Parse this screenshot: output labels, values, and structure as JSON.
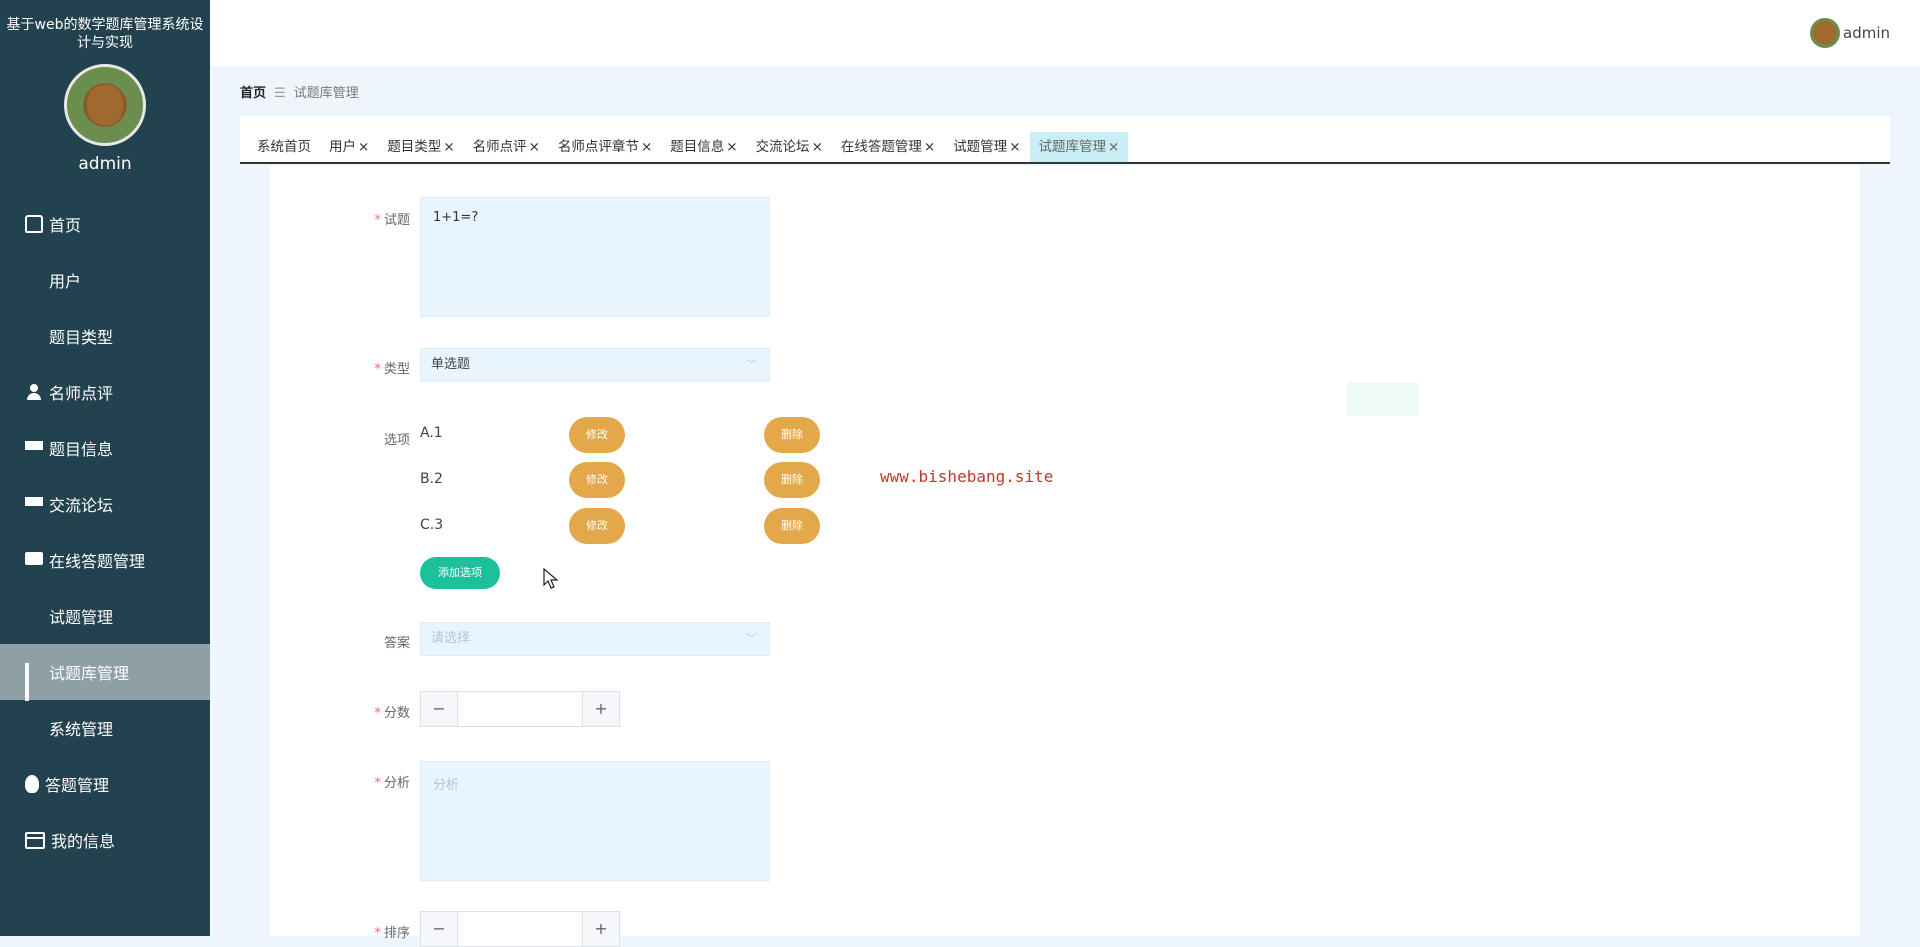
{
  "sidebar": {
    "system_title": "基于web的数学题库管理系统设计与实现",
    "username": "admin",
    "items": [
      {
        "label": "首页",
        "icon": "home-icon"
      },
      {
        "label": "用户",
        "icon": "grid-icon"
      },
      {
        "label": "题目类型",
        "icon": "grid-icon"
      },
      {
        "label": "名师点评",
        "icon": "user-icon"
      },
      {
        "label": "题目信息",
        "icon": "list-icon"
      },
      {
        "label": "交流论坛",
        "icon": "list-icon"
      },
      {
        "label": "在线答题管理",
        "icon": "chat-icon"
      },
      {
        "label": "试题管理",
        "icon": "grid-icon"
      },
      {
        "label": "试题库管理",
        "icon": "bar-chart-icon",
        "active": true
      },
      {
        "label": "系统管理",
        "icon": "grid-icon"
      },
      {
        "label": "答题管理",
        "icon": "bulb-icon"
      },
      {
        "label": "我的信息",
        "icon": "card-icon"
      }
    ]
  },
  "header": {
    "username": "admin"
  },
  "breadcrumb": {
    "home": "首页",
    "separator": "☰",
    "current": "试题库管理"
  },
  "tabs": [
    {
      "label": "系统首页",
      "closable": false
    },
    {
      "label": "用户",
      "closable": true
    },
    {
      "label": "题目类型",
      "closable": true
    },
    {
      "label": "名师点评",
      "closable": true
    },
    {
      "label": "名师点评章节",
      "closable": true
    },
    {
      "label": "题目信息",
      "closable": true
    },
    {
      "label": "交流论坛",
      "closable": true
    },
    {
      "label": "在线答题管理",
      "closable": true
    },
    {
      "label": "试题管理",
      "closable": true
    },
    {
      "label": "试题库管理",
      "closable": true,
      "active": true
    }
  ],
  "close_glyph": "×",
  "form": {
    "question_label": "试题",
    "question_value": "1+1=?",
    "type_label": "类型",
    "type_value": "单选题",
    "options_label": "选项",
    "options": [
      {
        "text": "A.1"
      },
      {
        "text": "B.2"
      },
      {
        "text": "C.3"
      }
    ],
    "edit_label": "修改",
    "delete_label": "删除",
    "add_option_label": "添加选项",
    "answer_label": "答案",
    "answer_placeholder": "请选择",
    "score_label": "分数",
    "analysis_label": "分析",
    "analysis_placeholder": "分析",
    "sort_label": "排序",
    "minus": "−",
    "plus": "+",
    "required_mark": "*"
  },
  "watermark": "www.bishebang.site",
  "colors": {
    "sidebar_bg": "#23424f",
    "active_menu": "#8e9fa6",
    "pill_orange": "#e3a84a",
    "add_green": "#1cc09a",
    "required_red": "#f56c6c",
    "active_tab": "#c9eef6"
  }
}
